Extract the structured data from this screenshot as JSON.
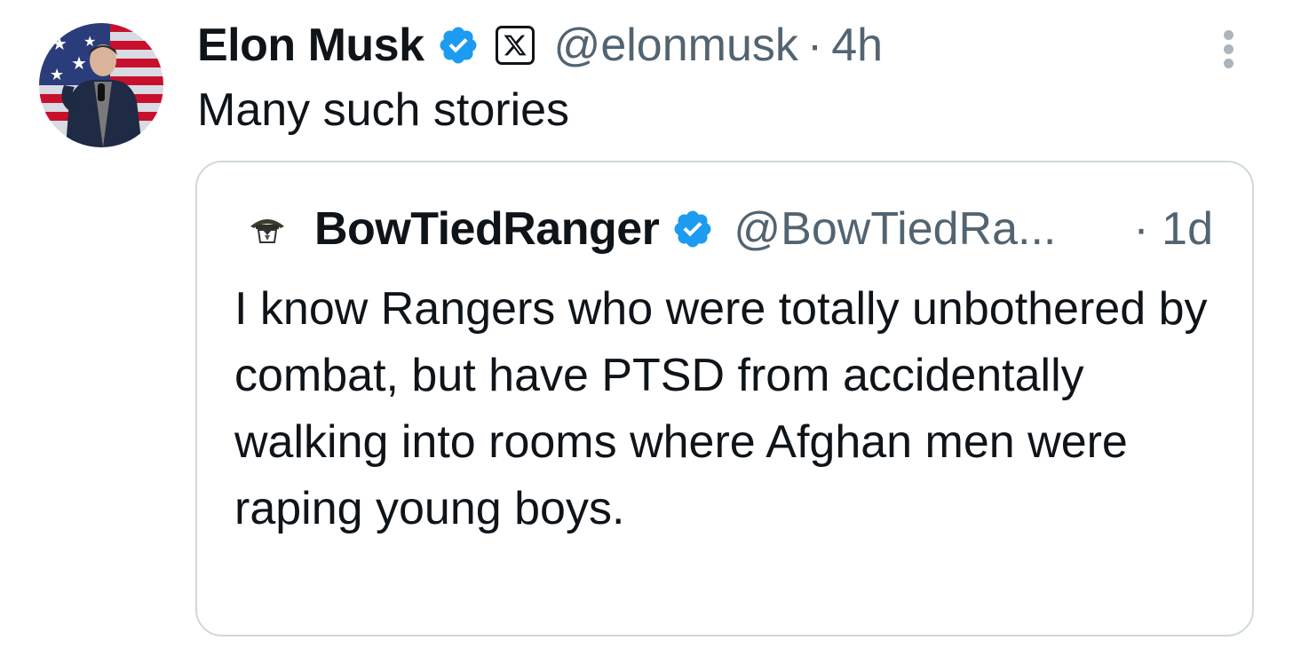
{
  "tweet": {
    "author_name": "Elon Musk",
    "author_handle": "@elonmusk",
    "separator": "·",
    "time": "4h",
    "text": "Many such stories",
    "avatar_icon": "elon-avatar",
    "verified_icon": "verified-badge-icon",
    "affiliate_icon": "x-logo-icon",
    "more_icon": "more-options-icon"
  },
  "quoted_tweet": {
    "author_name": "BowTiedRanger",
    "author_handle": "@BowTiedRa...",
    "time": "· 1d",
    "text": "I know Rangers who were totally unbothered by combat, but have PTSD from accidentally walking into rooms where Afghan men were raping young boys.",
    "avatar_icon": "ranger-avatar",
    "verified_icon": "verified-badge-icon"
  },
  "colors": {
    "verified_blue": "#1d9bf0",
    "secondary_text": "#536471",
    "border": "#cfd9de",
    "primary_text": "#0f1419"
  }
}
